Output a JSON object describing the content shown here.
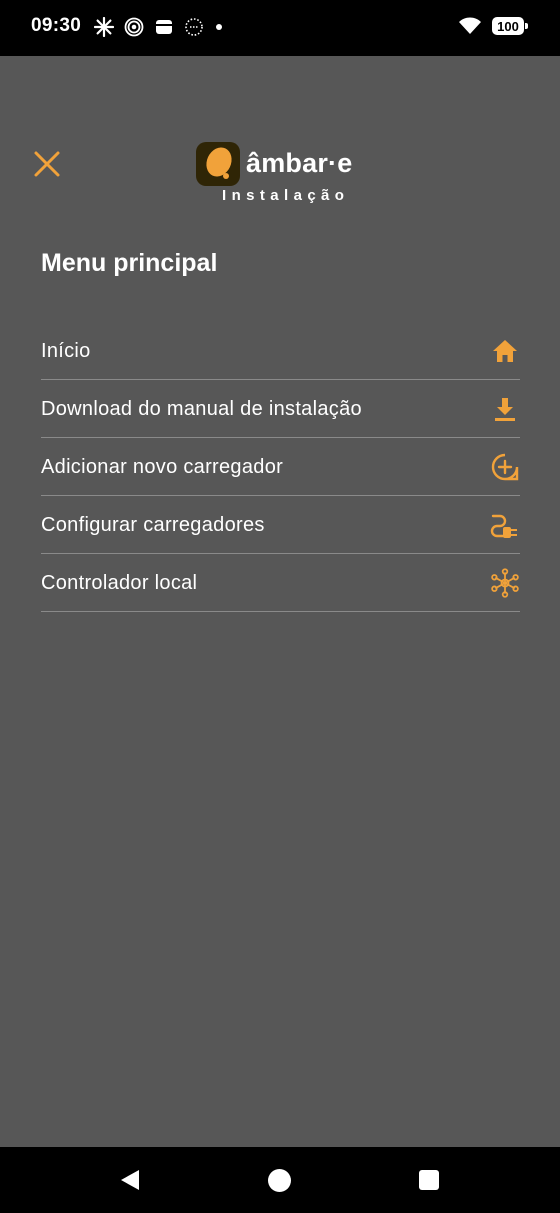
{
  "status_bar": {
    "time": "09:30",
    "battery": "100",
    "icons": [
      "sparkle-icon",
      "target-icon",
      "wallet-icon",
      "dotted-circle-icon",
      "dot-icon",
      "wifi-icon",
      "battery-icon"
    ]
  },
  "header": {
    "close_icon": "close-icon",
    "brand_name": "âmbar·e",
    "brand_sub": "Instalação",
    "accent_color": "#f1a23a"
  },
  "menu": {
    "title": "Menu principal",
    "items": [
      {
        "label": "Início",
        "icon": "home-icon"
      },
      {
        "label": "Download do manual de instalação",
        "icon": "download-icon"
      },
      {
        "label": "Adicionar novo carregador",
        "icon": "add-circle-icon"
      },
      {
        "label": "Configurar carregadores",
        "icon": "plug-icon"
      },
      {
        "label": "Controlador local",
        "icon": "network-hub-icon"
      }
    ]
  },
  "nav": {
    "icons": [
      "back-icon",
      "home-icon",
      "recents-icon"
    ]
  }
}
